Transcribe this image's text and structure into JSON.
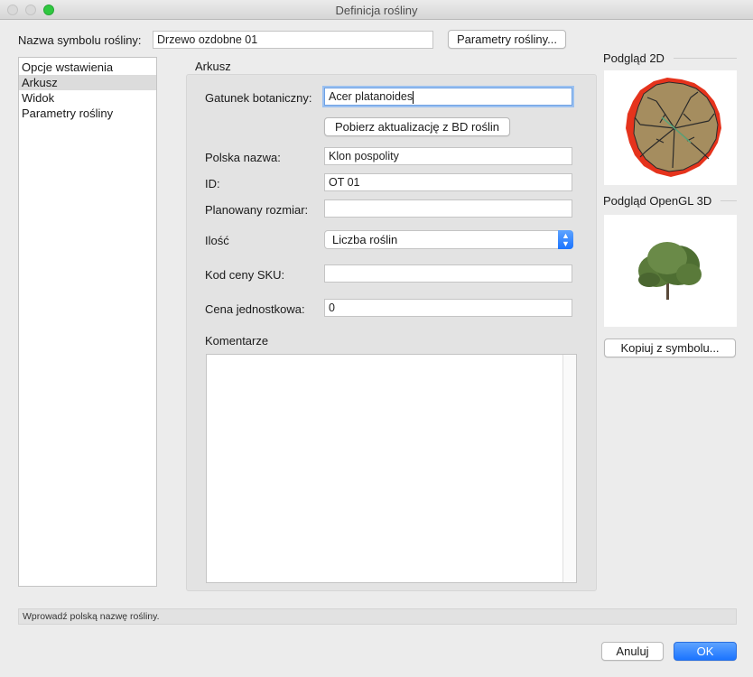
{
  "window": {
    "title": "Definicja rośliny"
  },
  "top": {
    "symbol_label": "Nazwa symbolu rośliny:",
    "symbol_value": "Drzewo ozdobne 01",
    "params_button": "Parametry rośliny..."
  },
  "sidebar": {
    "items": [
      {
        "label": "Opcje wstawienia"
      },
      {
        "label": "Arkusz"
      },
      {
        "label": "Widok"
      },
      {
        "label": "Parametry rośliny"
      }
    ]
  },
  "sheet": {
    "title": "Arkusz",
    "botanical_label": "Gatunek botaniczny:",
    "botanical_value": "Acer platanoides",
    "update_button": "Pobierz aktualizację z BD roślin",
    "polish_label": "Polska nazwa:",
    "polish_value": "Klon pospolity",
    "id_label": "ID:",
    "id_value": "OT 01",
    "size_label": "Planowany rozmiar:",
    "size_value": "",
    "qty_label": "Ilość",
    "qty_value": "Liczba roślin",
    "sku_label": "Kod ceny SKU:",
    "sku_value": "",
    "price_label": "Cena jednostkowa:",
    "price_value": "0",
    "comments_label": "Komentarze"
  },
  "preview": {
    "label_2d": "Podgląd 2D",
    "label_3d": "Podgląd OpenGL 3D",
    "copy_button": "Kopiuj z symbolu..."
  },
  "status": {
    "text": "Wprowadź polską nazwę rośliny."
  },
  "footer": {
    "cancel": "Anuluj",
    "ok": "OK"
  },
  "colors": {
    "accent": "#1b74ff",
    "tree_fill": "#a58d5f",
    "tree_outline": "#e5331c"
  }
}
